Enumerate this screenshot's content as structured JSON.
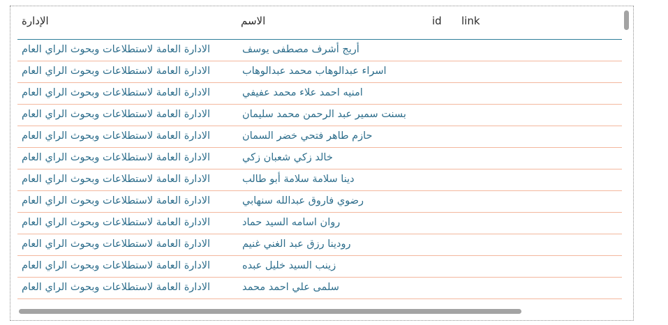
{
  "table": {
    "headers": {
      "department": "الإدارة",
      "name": "الاسم",
      "id": "id",
      "link": "link"
    },
    "rows": [
      {
        "name": "أريج أشرف مصطفى يوسف",
        "department": "الادارة العامة لاستطلاعات وبحوث الراي العام"
      },
      {
        "name": "اسراء عبدالوهاب محمد عبدالوهاب",
        "department": "الادارة العامة لاستطلاعات وبحوث الراي العام"
      },
      {
        "name": "امنيه احمد علاء محمد عفيفي",
        "department": "الادارة العامة لاستطلاعات وبحوث الراي العام"
      },
      {
        "name": "بسنت سمير عبد الرحمن محمد سليمان",
        "department": "الادارة العامة لاستطلاعات وبحوث الراي العام"
      },
      {
        "name": "حازم طاهر فتحي خضر السمان",
        "department": "الادارة العامة لاستطلاعات وبحوث الراي العام"
      },
      {
        "name": "خالد زكي شعبان زكي",
        "department": "الادارة العامة لاستطلاعات وبحوث الراي العام"
      },
      {
        "name": "دينا سلامة سلامة أبو طالب",
        "department": "الادارة العامة لاستطلاعات وبحوث الراي العام"
      },
      {
        "name": "رضوي فاروق عبدالله سنهابي",
        "department": "الادارة العامة لاستطلاعات وبحوث الراي العام"
      },
      {
        "name": "روان اسامه السيد حماد",
        "department": "الادارة العامة لاستطلاعات وبحوث الراي العام"
      },
      {
        "name": "رودينا رزق عبد الغني غنيم",
        "department": "الادارة العامة لاستطلاعات وبحوث الراي العام"
      },
      {
        "name": "زينب السيد خليل عبده",
        "department": "الادارة العامة لاستطلاعات وبحوث الراي العام"
      },
      {
        "name": "سلمى علي احمد محمد",
        "department": "الادارة العامة لاستطلاعات وبحوث الراي العام"
      }
    ]
  }
}
